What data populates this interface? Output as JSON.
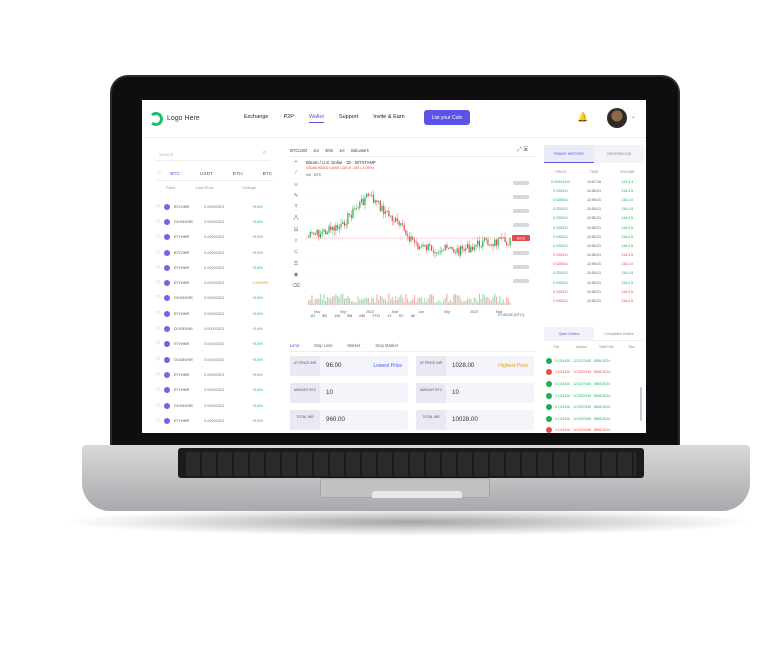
{
  "topnav": {
    "logo_text": "Logo Here",
    "menu": [
      "Exchange",
      "P2P",
      "Wallet",
      "Support",
      "Invite & Earn"
    ],
    "active_menu": "Wallet",
    "cta_label": "List your Coin"
  },
  "left": {
    "search_placeholder": "Search",
    "tabs": [
      "BTC",
      "USDT",
      "ETH",
      "BTC"
    ],
    "active_tab": 0,
    "columns": [
      "Pairs",
      "Last Price",
      "Change"
    ],
    "pairs": [
      {
        "name": "BTC/INR",
        "price": "0.00000323",
        "change": "+3.6%"
      },
      {
        "name": "DOGE/INR",
        "price": "0.00000323",
        "change": "+3.6%"
      },
      {
        "name": "ETH/INR",
        "price": "0.00000323",
        "change": "+3.6%"
      },
      {
        "name": "BTC/INR",
        "price": "0.00000323",
        "change": "+3.6%"
      },
      {
        "name": "ETH/INR",
        "price": "0.00000323",
        "change": "+3.6%"
      },
      {
        "name": "ETH/INR",
        "price": "0.00000323",
        "change": "-0.0000%",
        "neg": true
      },
      {
        "name": "DOGE/INR",
        "price": "0.00000323",
        "change": "+3.6%"
      },
      {
        "name": "ETH/INR",
        "price": "0.00000323",
        "change": "+3.6%"
      },
      {
        "name": "DOGE/INR",
        "price": "0.00000323",
        "change": "+3.6%"
      },
      {
        "name": "ETH/INR",
        "price": "0.00000323",
        "change": "+3.6%"
      },
      {
        "name": "DOGE/INR",
        "price": "0.00000323",
        "change": "+3.6%"
      },
      {
        "name": "ETH/INR",
        "price": "0.00000323",
        "change": "+3.6%"
      },
      {
        "name": "ETH/INR",
        "price": "0.00000323",
        "change": "+3.6%"
      },
      {
        "name": "DOGE/INR",
        "price": "0.00000323",
        "change": "+3.6%"
      },
      {
        "name": "ETH/INR",
        "price": "0.00000323",
        "change": "+3.6%"
      },
      {
        "name": "ETH/INR",
        "price": "0.00000323",
        "change": "+3.6%"
      }
    ]
  },
  "chart": {
    "symbol": "BTCUSD",
    "intervals": [
      "1m",
      "30m",
      "1H"
    ],
    "indicators_label": "Indicators",
    "title": "Bitcoin / U.S. Dollar · 1D · BITSTAMP",
    "ohlc": "O8358 H8400 L8006 C8015 -195 (-4.05%)",
    "sub": "Vol · BTC",
    "x_ticks": [
      "Nov",
      "Sep",
      "2023",
      "Mar",
      "Jun",
      "Sep",
      "2023",
      "Mar"
    ],
    "timeframes": [
      "1D",
      "5D",
      "1M",
      "3M",
      "6M",
      "YTD",
      "1Y",
      "5Y",
      "All"
    ],
    "utc": "07:05:05 (UTC)",
    "last_price_label": "8015"
  },
  "order": {
    "tabs": [
      "Limit",
      "Stop Limit",
      "Market",
      "Stop Market"
    ],
    "active_tab": 0,
    "fields": [
      {
        "label": "AT PRICE INR",
        "value": "96.00",
        "hint": "Lowest Price",
        "tone": "blue"
      },
      {
        "label": "AT PRICE INR",
        "value": "1028.00",
        "hint": "Highest Price",
        "tone": "orange"
      },
      {
        "label": "AMOUNT BTC",
        "value": "10",
        "hint": "",
        "tone": ""
      },
      {
        "label": "AMOUNT BTC",
        "value": "10",
        "hint": "",
        "tone": ""
      },
      {
        "label": "TOTAL INR",
        "value": "960.00",
        "hint": "",
        "tone": ""
      },
      {
        "label": "TOTAL INR",
        "value": "10028.00",
        "hint": "",
        "tone": ""
      }
    ]
  },
  "trades": {
    "tabs": [
      "TRADE HISTORY",
      "ORDERBOOK"
    ],
    "active_tab": 0,
    "columns": [
      "PRICE",
      "TIME",
      "VOLUME"
    ],
    "rows": [
      {
        "price": "0.00001412",
        "time": "14:57:15",
        "vol": "113.4.4",
        "side": "g"
      },
      {
        "price": "0.020511",
        "time": "12:55:21",
        "vol": "116.4.5",
        "side": "g"
      },
      {
        "price": "0.020511",
        "time": "12:55:21",
        "vol": "116.4.5",
        "side": "g"
      },
      {
        "price": "0.020511",
        "time": "12:55:21",
        "vol": "116.4.5",
        "side": "g"
      },
      {
        "price": "0.020511",
        "time": "12:55:21",
        "vol": "116.4.5",
        "side": "g"
      },
      {
        "price": "0.020511",
        "time": "12:55:21",
        "vol": "116.4.5",
        "side": "g"
      },
      {
        "price": "0.020511",
        "time": "12:55:21",
        "vol": "116.4.5",
        "side": "g"
      },
      {
        "price": "0.020511",
        "time": "12:55:21",
        "vol": "116.4.5",
        "side": "g"
      },
      {
        "price": "0.020511",
        "time": "12:55:21",
        "vol": "116.4.5",
        "side": "r"
      },
      {
        "price": "0.020511",
        "time": "12:55:21",
        "vol": "116.4.5",
        "side": "r"
      },
      {
        "price": "0.020511",
        "time": "12:55:21",
        "vol": "116.4.5",
        "side": "g"
      },
      {
        "price": "0.020511",
        "time": "12:55:21",
        "vol": "116.4.5",
        "side": "g"
      },
      {
        "price": "0.020511",
        "time": "12:55:21",
        "vol": "116.4.5",
        "side": "r"
      },
      {
        "price": "0.020511",
        "time": "12:55:21",
        "vol": "116.4.5",
        "side": "r"
      }
    ]
  },
  "open_orders": {
    "tabs": [
      "Open Orders",
      "Completed Orders"
    ],
    "active_tab": 0,
    "columns": [
      "Pair",
      "Amount",
      "Total Price",
      "Time"
    ],
    "rows": [
      {
        "a": "0.13.4400",
        "b": "12,0237445",
        "c": "8854.5224",
        "side": "g"
      },
      {
        "a": "0.13.4400",
        "b": "12,0237445",
        "c": "8854.5224",
        "side": "r"
      },
      {
        "a": "0.13.4400",
        "b": "12,0237445",
        "c": "8854.5224",
        "side": "g"
      },
      {
        "a": "0.13.4400",
        "b": "12,0237445",
        "c": "8854.5224",
        "side": "g"
      },
      {
        "a": "0.13.4400",
        "b": "12,0237445",
        "c": "8854.5224",
        "side": "g"
      },
      {
        "a": "0.13.4400",
        "b": "12,0237445",
        "c": "8854.5224",
        "side": "g"
      },
      {
        "a": "0.13.4400",
        "b": "12,0237445",
        "c": "8854.5224",
        "side": "r"
      }
    ]
  },
  "colors": {
    "accent": "#5b53e6",
    "up": "#1fae54",
    "down": "#e14c4c",
    "logo": "#1fbf6a"
  }
}
